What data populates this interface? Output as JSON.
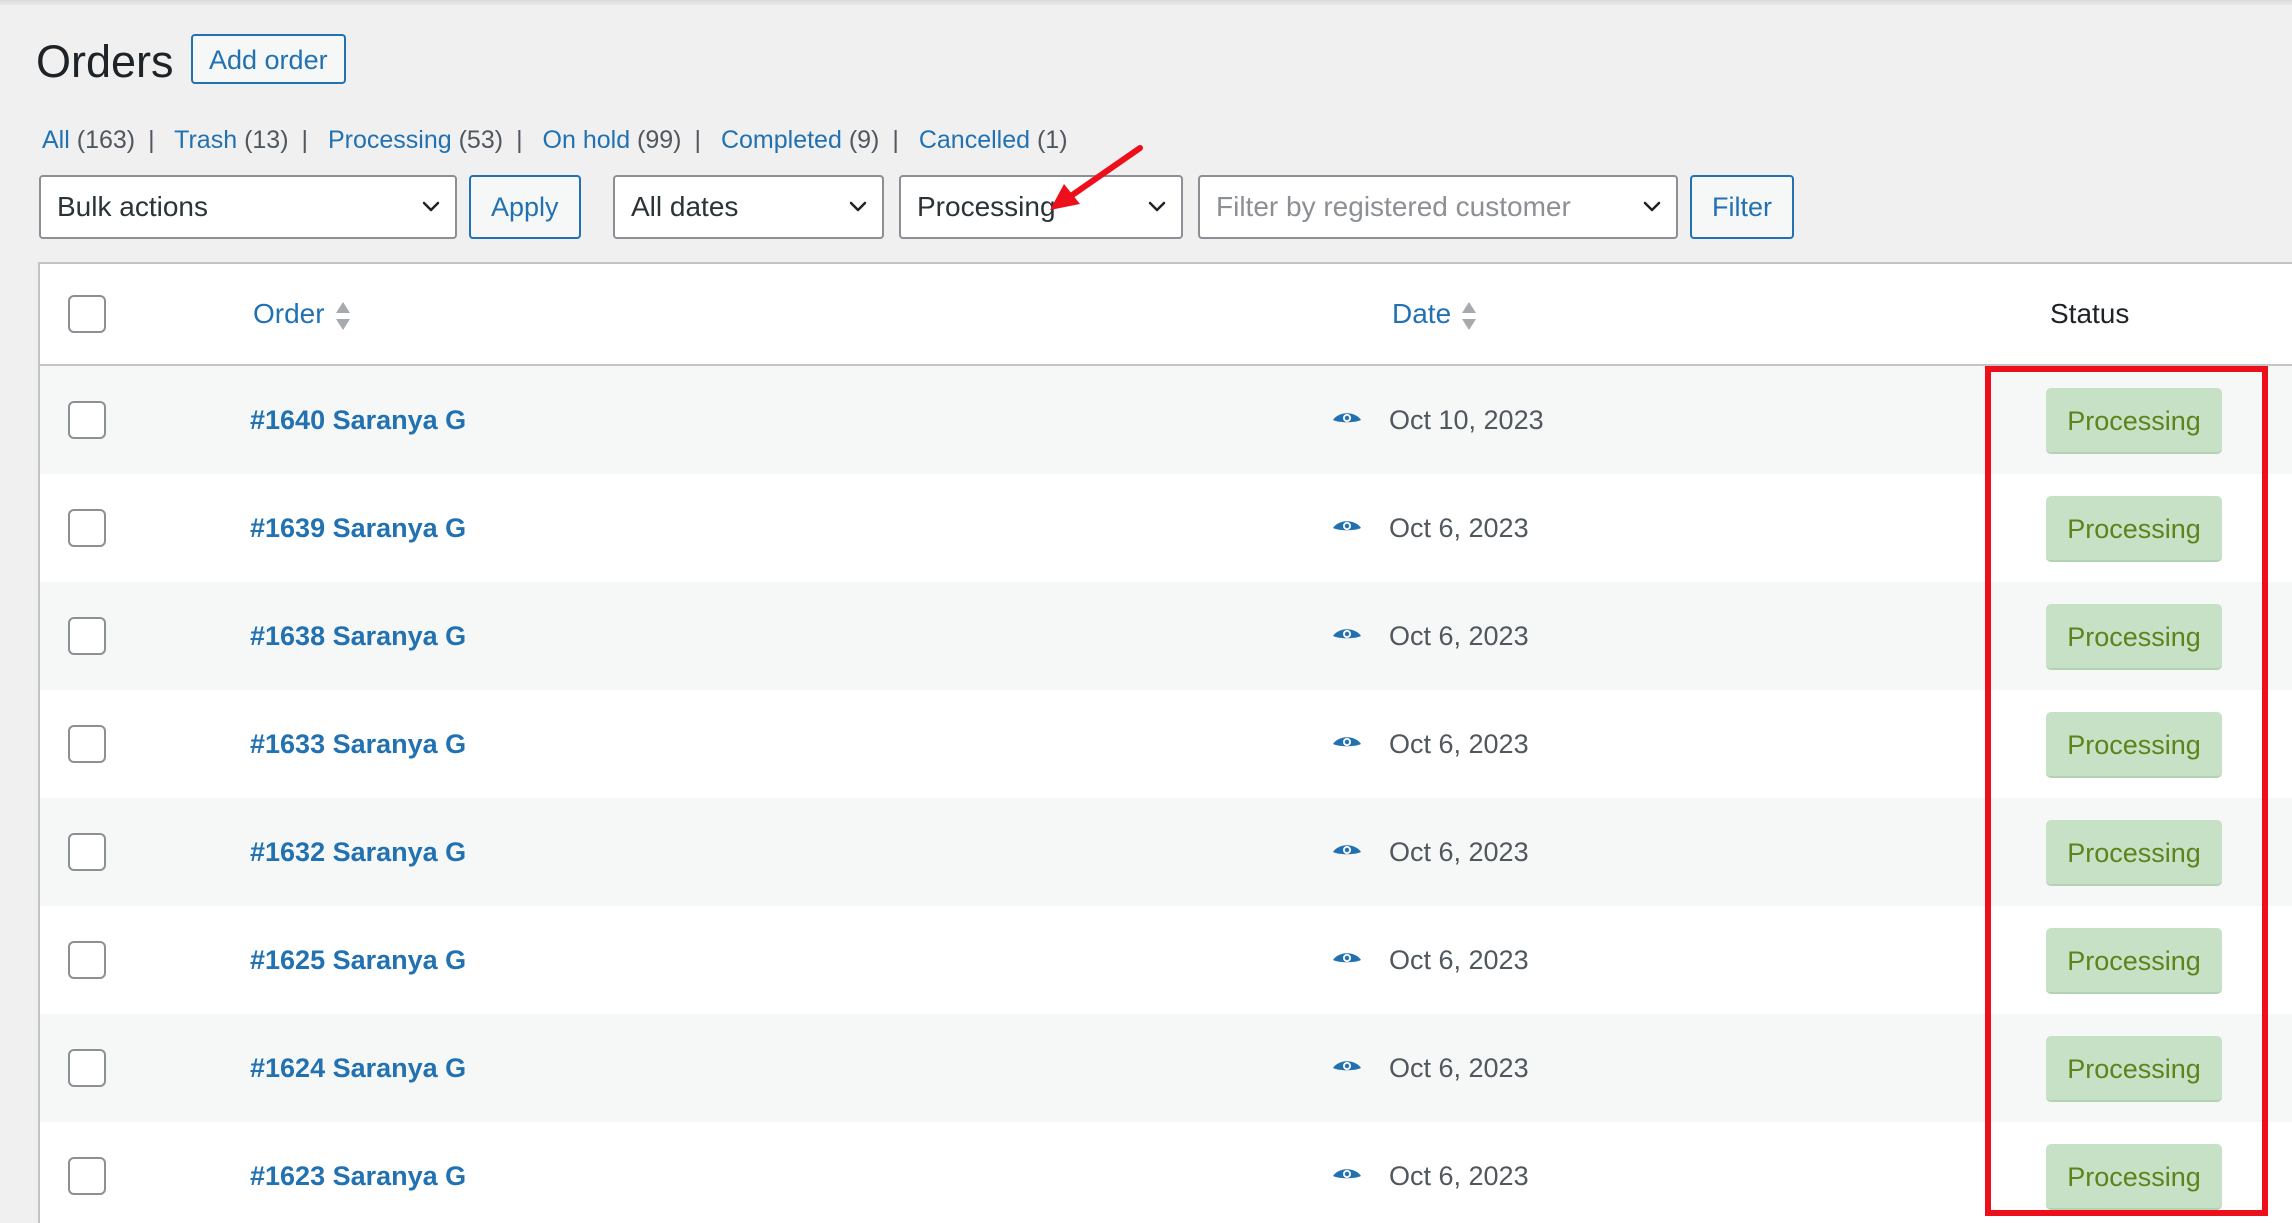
{
  "header": {
    "title": "Orders",
    "add_button": "Add order"
  },
  "views": [
    {
      "label": "All",
      "count": "(163)"
    },
    {
      "label": "Trash",
      "count": "(13)"
    },
    {
      "label": "Processing",
      "count": "(53)"
    },
    {
      "label": "On hold",
      "count": "(99)"
    },
    {
      "label": "Completed",
      "count": "(9)"
    },
    {
      "label": "Cancelled",
      "count": "(1)"
    }
  ],
  "filters": {
    "bulk_actions": "Bulk actions",
    "apply": "Apply",
    "dates": "All dates",
    "status": "Processing",
    "customer_placeholder": "Filter by registered customer",
    "filter": "Filter"
  },
  "table": {
    "columns": {
      "order": "Order",
      "date": "Date",
      "status": "Status"
    },
    "rows": [
      {
        "order": "#1640 Saranya G",
        "date": "Oct 10, 2023",
        "status": "Processing"
      },
      {
        "order": "#1639 Saranya G",
        "date": "Oct 6, 2023",
        "status": "Processing"
      },
      {
        "order": "#1638 Saranya G",
        "date": "Oct 6, 2023",
        "status": "Processing"
      },
      {
        "order": "#1633 Saranya G",
        "date": "Oct 6, 2023",
        "status": "Processing"
      },
      {
        "order": "#1632 Saranya G",
        "date": "Oct 6, 2023",
        "status": "Processing"
      },
      {
        "order": "#1625 Saranya G",
        "date": "Oct 6, 2023",
        "status": "Processing"
      },
      {
        "order": "#1624 Saranya G",
        "date": "Oct 6, 2023",
        "status": "Processing"
      },
      {
        "order": "#1623 Saranya G",
        "date": "Oct 6, 2023",
        "status": "Processing"
      }
    ]
  },
  "icons": {
    "dropdown": "chevron-down-icon",
    "sort": "sort-icon",
    "preview": "eye-icon"
  },
  "colors": {
    "link": "#2271b1",
    "status_bg": "#c6e1c6",
    "status_text": "#5b841b",
    "annotation": "#ee0f1c"
  }
}
